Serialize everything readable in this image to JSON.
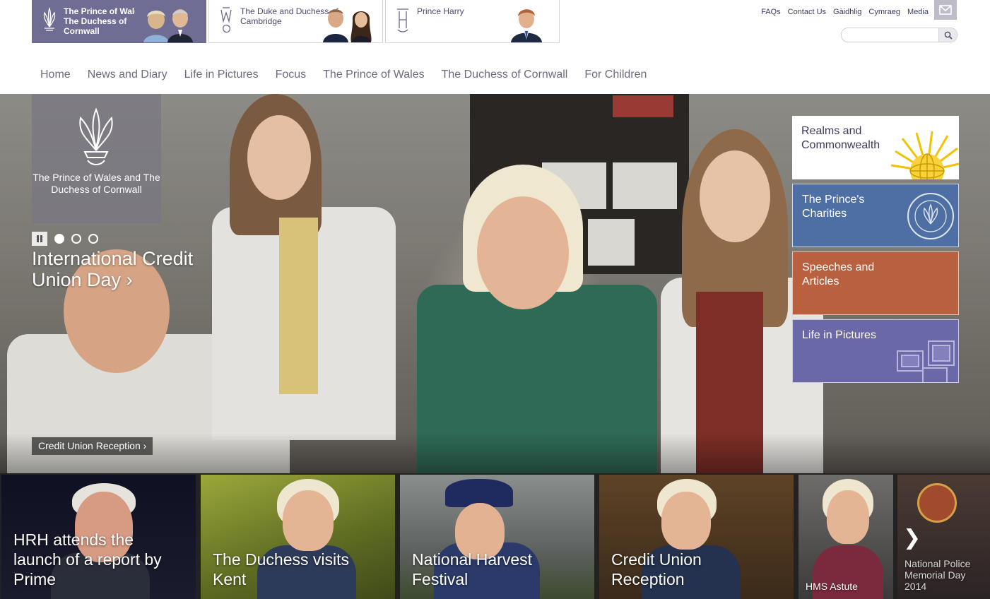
{
  "royal_tabs": [
    {
      "label": "The Prince of Wales and The Duchess of Cornwall",
      "active": true
    },
    {
      "label": "The Duke and Duchess of Cambridge",
      "active": false
    },
    {
      "label": "Prince Harry",
      "active": false
    }
  ],
  "utility_links": [
    "FAQs",
    "Contact Us",
    "Gàidhlig",
    "Cymraeg",
    "Media"
  ],
  "search": {
    "placeholder": ""
  },
  "main_nav": [
    "Home",
    "News and Diary",
    "Life in Pictures",
    "Focus",
    "The Prince of Wales",
    "The Duchess of Cornwall",
    "For Children"
  ],
  "hero": {
    "crest_label": "The Prince of Wales and The Duchess of Cornwall",
    "slide_count": 3,
    "active_slide": 1,
    "title": "International Credit Union Day",
    "caption": "Credit Union Reception"
  },
  "side_panels": [
    {
      "label": "Realms and Commonwealth"
    },
    {
      "label": "The Prince's Charities"
    },
    {
      "label": "Speeches and Articles"
    },
    {
      "label": "Life in Pictures"
    }
  ],
  "tiles": [
    {
      "title": "HRH attends the launch of a report by Prime"
    },
    {
      "title": "The Duchess visits Kent"
    },
    {
      "title": "National Harvest Festival"
    },
    {
      "title": "Credit Union Reception"
    },
    {
      "title": "HMS Astute"
    },
    {
      "title": "National Police Memorial Day 2014"
    }
  ],
  "colors": {
    "brand_purple": "#6f6d93",
    "charities_blue": "#4e6fa3",
    "speeches_orange": "#b9603e",
    "pictures_purple": "#6a68a6"
  },
  "icons": {
    "mail": "envelope-icon",
    "search": "magnifier-icon",
    "pause": "pause-icon",
    "next": "chevron-right-icon"
  }
}
